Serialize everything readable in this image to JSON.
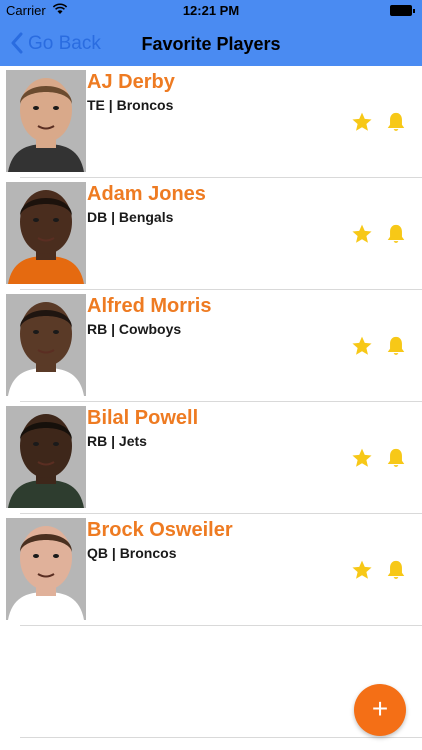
{
  "status_bar": {
    "carrier": "Carrier",
    "time": "12:21 PM"
  },
  "nav": {
    "back_label": "Go Back",
    "title": "Favorite Players"
  },
  "colors": {
    "nav_bg": "#4a8bf2",
    "name": "#ee7b22",
    "icon": "#f7c817",
    "fab": "#f46f16"
  },
  "players": [
    {
      "name": "AJ Derby",
      "info": "TE | Broncos",
      "skin": "#d9a98a",
      "hair": "#6b4b2f",
      "shirt": "#333333"
    },
    {
      "name": "Adam Jones",
      "info": "DB | Bengals",
      "skin": "#4a2d1e",
      "hair": "#1c120c",
      "shirt": "#e56a10"
    },
    {
      "name": "Alfred Morris",
      "info": "RB | Cowboys",
      "skin": "#5a3a27",
      "hair": "#1f1510",
      "shirt": "#ffffff"
    },
    {
      "name": "Bilal Powell",
      "info": "RB | Jets",
      "skin": "#3e271a",
      "hair": "#16100b",
      "shirt": "#2e3d2f"
    },
    {
      "name": "Brock Osweiler",
      "info": "QB | Broncos",
      "skin": "#e0b19a",
      "hair": "#4a3020",
      "shirt": "#ffffff"
    }
  ],
  "fab_label": "+"
}
